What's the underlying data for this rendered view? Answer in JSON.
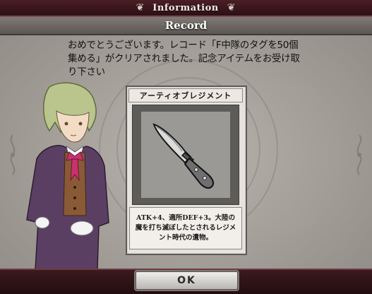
{
  "header": {
    "title": "Information",
    "left_ornament_icon": "fleur-ornament-icon",
    "right_ornament_icon": "fleur-ornament-icon"
  },
  "record": {
    "title": "Record"
  },
  "message": {
    "text": "おめでとうございます。レコード「F中隊のタグを50個集める」がクリアされました。記念アイテムをお受け取り下さい"
  },
  "item_card": {
    "name": "アーティオブレジメント",
    "item_icon": "combat-knife-icon",
    "description": "ATK+4、適所DEF+3。大陸の魔を打ち滅ぼしたとされるレジメント時代の遺物。"
  },
  "character": {
    "icon": "character-portrait"
  },
  "footer": {
    "ok_label": "OK"
  },
  "colors": {
    "top_bar": "#3a161a",
    "panel": "#a9a59f",
    "record_bar": "#6b6662",
    "card_bg": "#e6e3de"
  }
}
